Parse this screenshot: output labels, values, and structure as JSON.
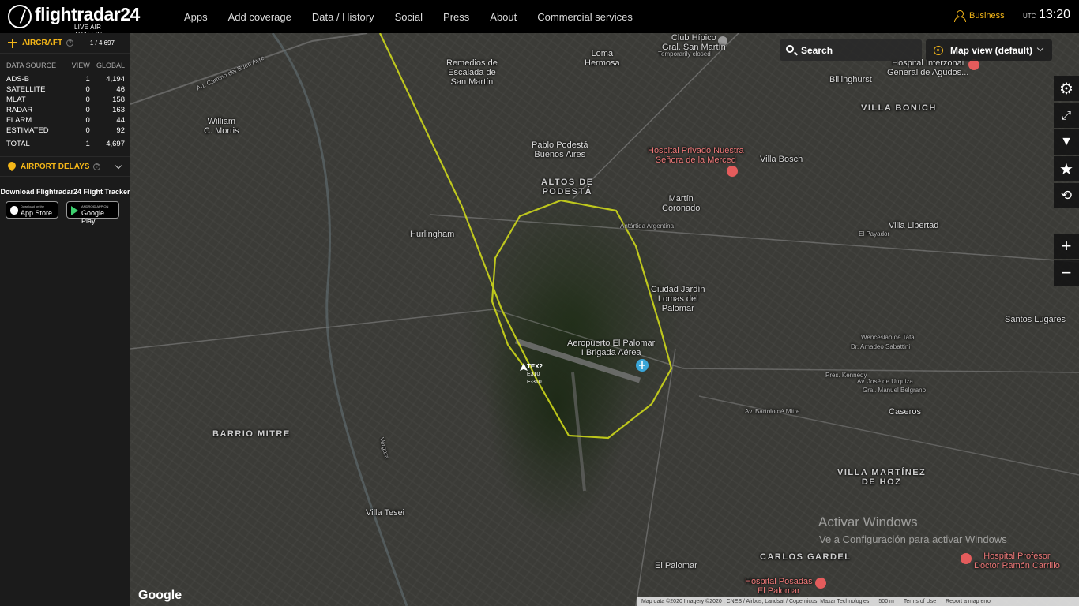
{
  "header": {
    "logo_text": "flightradar24",
    "logo_sub": "LIVE AIR TRAFFIC",
    "nav": [
      "Apps",
      "Add coverage",
      "Data / History",
      "Social",
      "Press",
      "About",
      "Commercial services"
    ],
    "business": "Business",
    "utc_label": "UTC",
    "time": "13:20"
  },
  "sidebar": {
    "aircraft_title": "AIRCRAFT",
    "aircraft_count": "1 / 4,697",
    "columns": [
      "DATA SOURCE",
      "VIEW",
      "GLOBAL"
    ],
    "rows": [
      {
        "source": "ADS-B",
        "view": "1",
        "global": "4,194"
      },
      {
        "source": "SATELLITE",
        "view": "0",
        "global": "46"
      },
      {
        "source": "MLAT",
        "view": "0",
        "global": "158"
      },
      {
        "source": "RADAR",
        "view": "0",
        "global": "163"
      },
      {
        "source": "FLARM",
        "view": "0",
        "global": "44"
      },
      {
        "source": "ESTIMATED",
        "view": "0",
        "global": "92"
      }
    ],
    "total": {
      "source": "TOTAL",
      "view": "1",
      "global": "4,697"
    },
    "airport_delays_title": "AIRPORT DELAYS",
    "download_title": "Download Flightradar24 Flight Tracker",
    "appstore_small": "Download on the",
    "appstore_big": "App Store",
    "googleplay_small": "ANDROID APP ON",
    "googleplay_big": "Google Play"
  },
  "map": {
    "search_label": "Search",
    "map_view_label": "Map view (default)",
    "tools": [
      "gear-icon",
      "fullscreen-icon",
      "filter-icon",
      "star-icon",
      "playback-icon",
      "zoom-in-icon",
      "zoom-out-icon"
    ],
    "aircraft": {
      "callsign": "TEX2",
      "line2": "E310",
      "line3": "E-310"
    },
    "places": {
      "p1": "Remedios de\nEscalada de\nSan Martín",
      "p2": "Loma\nHermosa",
      "p3": "Club Hípico\nGral. San Martín",
      "p3b": "Temporarily closed",
      "p4": "Hospital Interzonal\nGeneral de Agudos...",
      "p5": "Billinghurst",
      "p6": "VILLA BONICH",
      "p7": "William\nC. Morris",
      "p8": "Pablo Podestá\nBuenos Aires",
      "p9": "Hospital Privado Nuestra\nSeñora de la Merced",
      "p10": "Villa Bosch",
      "p11": "ALTOS DE\nPODESTÁ",
      "p12": "Martín\nCoronado",
      "p13": "Villa Libertad",
      "p14": "Hurlingham",
      "p15": "Ciudad Jardín\nLomas del\nPalomar",
      "p16": "Santos Lugares",
      "p17": "Aeropuerto El Palomar\nI Brigada Aérea",
      "p18": "BARRIO MITRE",
      "p19": "Caseros",
      "p20": "VILLA MARTÍNEZ\nDE HOZ",
      "p21": "Villa Tesei",
      "p22": "El Palomar",
      "p23": "CARLOS GARDEL",
      "p24": "Hospital Profesor\nDoctor Ramón Carrillo",
      "p25": "Hospital Posadas\nEl Palomar",
      "p26": "Av. Bartolomé Mitre",
      "p27": "Pres. Kennedy",
      "p28": "Antártida Argentina",
      "p29": "El Payador",
      "p30": "Wenceslao de Tata",
      "p31": "Dr. Amadeo Sabattini",
      "p32": "Av. José de Urquiza",
      "p33": "Gral. Manuel Belgrano",
      "p34": "Au. Camino del Buen Ayre",
      "p35": "Vergara"
    },
    "google": "Google",
    "attribution": "Map data ©2020 Imagery ©2020 , CNES / Airbus, Landsat / Copernicus, Maxar Technologies",
    "scale": "500 m",
    "terms": "Terms of Use",
    "report": "Report a map error",
    "watermark_1": "Activar Windows",
    "watermark_2": "Ve a Configuración para activar Windows"
  }
}
